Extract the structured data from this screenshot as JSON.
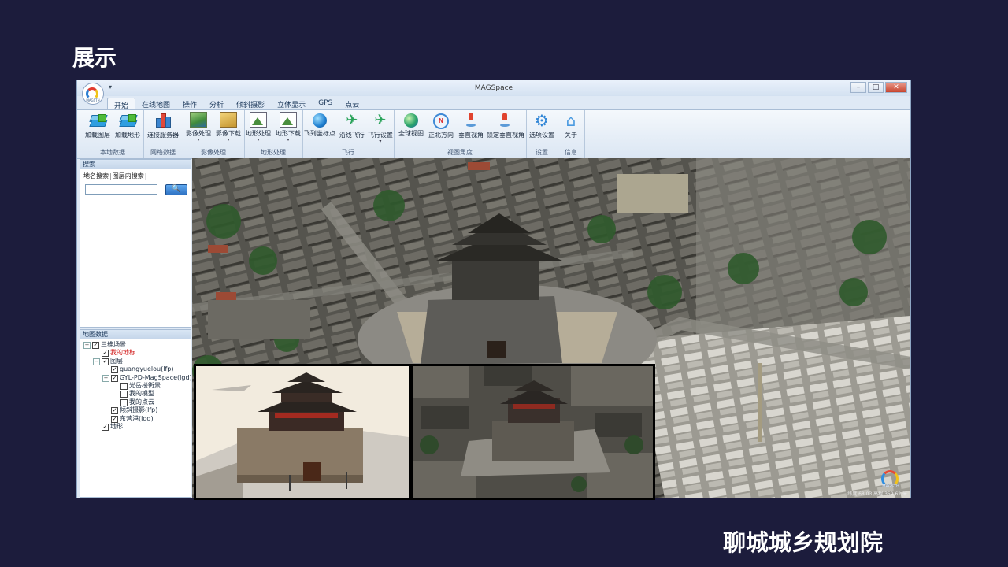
{
  "slide": {
    "title": "展示",
    "footer": "聊城城乡规划院"
  },
  "window": {
    "title": "MAGSpace",
    "logo_text": "MAGSTH",
    "controls": {
      "minimize": "–",
      "maximize": "□",
      "close": "✕"
    }
  },
  "tabs": [
    "开始",
    "在线地图",
    "操作",
    "分析",
    "倾斜摄影",
    "立体显示",
    "GPS",
    "点云"
  ],
  "ribbon": {
    "groups": [
      {
        "label": "本地数据",
        "buttons": [
          {
            "label": "加载图层",
            "icon": "layers-icon"
          },
          {
            "label": "加载地形",
            "icon": "terrain-layers-icon"
          }
        ]
      },
      {
        "label": "网络数据",
        "buttons": [
          {
            "label": "连接服务器",
            "icon": "server-icon"
          }
        ]
      },
      {
        "label": "影像处理",
        "buttons": [
          {
            "label": "影像处理",
            "icon": "image-process-icon",
            "dropdown": "▾"
          },
          {
            "label": "影像下载",
            "icon": "image-download-icon",
            "dropdown": "▾"
          }
        ]
      },
      {
        "label": "地形处理",
        "buttons": [
          {
            "label": "地形处理",
            "icon": "terrain-process-icon",
            "dropdown": "▾"
          },
          {
            "label": "地形下载",
            "icon": "terrain-download-icon",
            "dropdown": "▾"
          }
        ]
      },
      {
        "label": "飞行",
        "buttons": [
          {
            "label": "飞到坐标点",
            "icon": "fly-to-point-icon"
          },
          {
            "label": "沿线飞行",
            "icon": "fly-along-line-icon"
          },
          {
            "label": "飞行设置",
            "icon": "flight-settings-icon",
            "dropdown": "▾"
          }
        ]
      },
      {
        "label": "视图角度",
        "buttons": [
          {
            "label": "全球视图",
            "icon": "globe-icon"
          },
          {
            "label": "正北方向",
            "icon": "compass-north-icon",
            "glyph": "N"
          },
          {
            "label": "垂直视角",
            "icon": "vertical-view-icon"
          },
          {
            "label": "锁定垂直视角",
            "icon": "lock-vertical-view-icon"
          }
        ]
      },
      {
        "label": "设置",
        "buttons": [
          {
            "label": "选项设置",
            "icon": "gear-icon",
            "glyph": "⚙"
          }
        ]
      },
      {
        "label": "信息",
        "buttons": [
          {
            "label": "关于",
            "icon": "home-icon",
            "glyph": "⌂"
          }
        ]
      }
    ],
    "plane_glyph": "✈"
  },
  "search_panel": {
    "header": "搜索",
    "subtabs": [
      "地名搜索",
      "图层内搜索"
    ],
    "separator": "|",
    "input_value": "",
    "search_icon": "🔍"
  },
  "data_panel": {
    "header": "地图数据",
    "tree": [
      {
        "level": 0,
        "expander": "−",
        "checked": true,
        "label": "三维场景"
      },
      {
        "level": 1,
        "expander": "",
        "checked": true,
        "label": "我的地标",
        "red": true
      },
      {
        "level": 1,
        "expander": "−",
        "checked": true,
        "label": "图层"
      },
      {
        "level": 2,
        "expander": "",
        "checked": true,
        "label": "guangyuelou(lfp)"
      },
      {
        "level": 2,
        "expander": "−",
        "checked": true,
        "label": "GYL-PD-MagSpace(lgd)"
      },
      {
        "level": 3,
        "expander": "",
        "checked": false,
        "label": "光岳楼街景"
      },
      {
        "level": 3,
        "expander": "",
        "checked": false,
        "label": "我的模型"
      },
      {
        "level": 3,
        "expander": "",
        "checked": false,
        "label": "我的点云"
      },
      {
        "level": 2,
        "expander": "",
        "checked": true,
        "label": "倾斜摄影(lfp)"
      },
      {
        "level": 2,
        "expander": "",
        "checked": true,
        "label": "东营港(lqd)"
      },
      {
        "level": 1,
        "expander": "",
        "checked": true,
        "label": "地形"
      }
    ],
    "check_glyph": "✓"
  },
  "map": {
    "status": "纬度 68.03  高程 359.62 米",
    "logo_text": "MAGSTH"
  }
}
